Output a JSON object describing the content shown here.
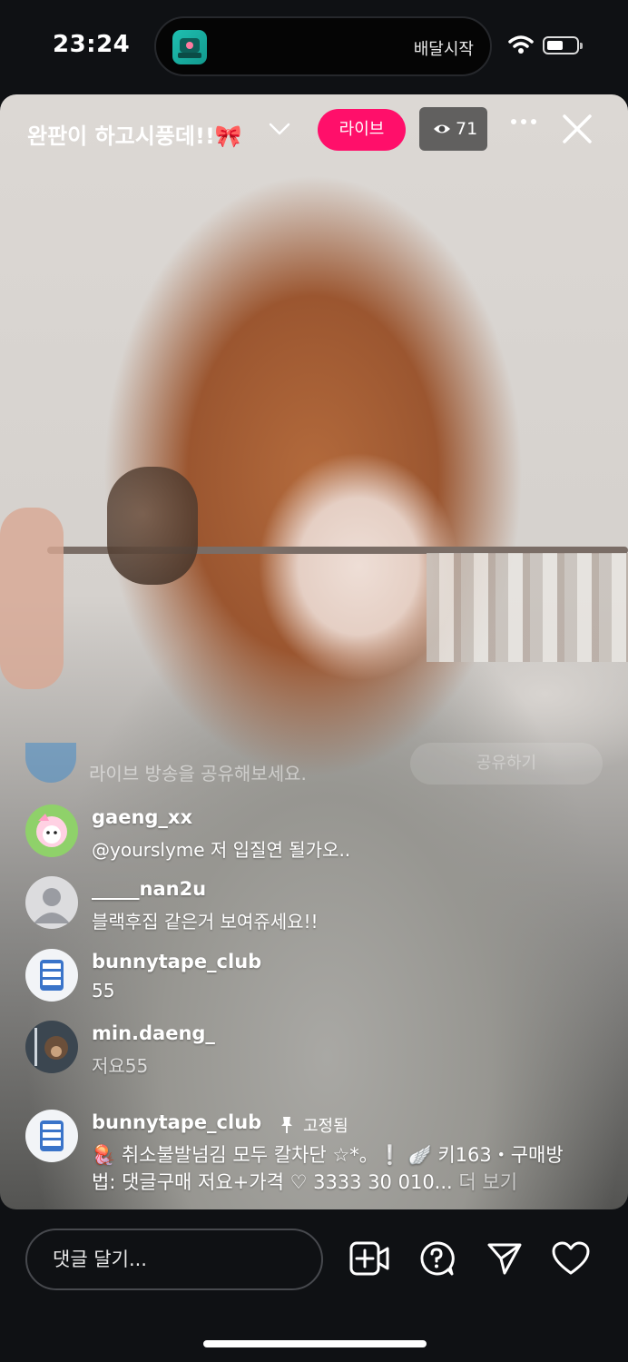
{
  "status_bar": {
    "time": "23:24",
    "island_text": "배달시작"
  },
  "live": {
    "title": "완판이 하고시풍데!!🎀",
    "badge": "라이브",
    "viewer_count": "71"
  },
  "share": {
    "text": "라이브 방송을 공유해보세요.",
    "button": "공유하기"
  },
  "comments": [
    {
      "user": "gaeng_xx",
      "text": "@yourslyme 저 입질연 될가오.."
    },
    {
      "user": "_____nan2u",
      "text": "블랙후집 같은거 보여쥬세요!!"
    },
    {
      "user": "bunnytape_club",
      "text": "55"
    },
    {
      "user": "min.daeng_",
      "text": "저요55"
    }
  ],
  "pinned": {
    "user": "bunnytape_club",
    "label": "고정됨",
    "line1": "🪼 취소불발넘김 모두 칼차단 ☆*。❕ 🪽 키163・구매방",
    "line2": "법: 댓글구매 저요+가격 ♡ 3333 30 010...",
    "more": "더 보기"
  },
  "bottom": {
    "comment_placeholder": "댓글 달기..."
  },
  "colors": {
    "live_badge": "#ff0f6a",
    "background": "#0f1114"
  },
  "icons": [
    "wifi-icon",
    "battery-icon",
    "chevron-down-icon",
    "eye-icon",
    "more-icon",
    "close-icon",
    "pin-icon",
    "add-video-icon",
    "question-icon",
    "send-icon",
    "heart-icon"
  ]
}
